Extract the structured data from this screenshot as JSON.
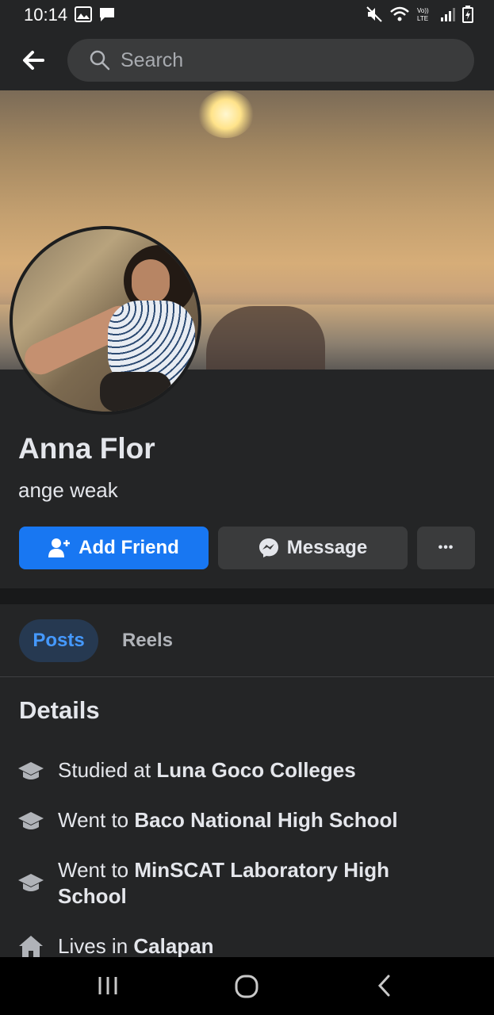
{
  "status_bar": {
    "time": "10:14",
    "left_icons": [
      "image-icon",
      "chat-icon"
    ],
    "right_icons": [
      "mute-icon",
      "wifi-icon",
      "volte-icon",
      "signal-icon",
      "battery-icon"
    ],
    "volte_label": "VoLTE"
  },
  "search": {
    "placeholder": "Search"
  },
  "profile": {
    "name": "Anna Flor",
    "bio": "ange weak"
  },
  "actions": {
    "add_friend": "Add Friend",
    "message": "Message",
    "more": "•••"
  },
  "tabs": [
    {
      "label": "Posts",
      "active": true
    },
    {
      "label": "Reels",
      "active": false
    }
  ],
  "details": {
    "title": "Details",
    "items": [
      {
        "icon": "graduation-cap-icon",
        "prefix": "Studied at ",
        "value": "Luna Goco Colleges"
      },
      {
        "icon": "graduation-cap-icon",
        "prefix": "Went to ",
        "value": "Baco National High School"
      },
      {
        "icon": "graduation-cap-icon",
        "prefix": "Went to ",
        "value": "MinSCAT Laboratory High School"
      },
      {
        "icon": "home-icon",
        "prefix": "Lives in ",
        "value": "Calapan"
      }
    ]
  },
  "colors": {
    "accent": "#1877f2",
    "background": "#242526",
    "tab_active_bg": "#263951",
    "tab_active_text": "#4599ff"
  },
  "nav_bar": {
    "buttons": [
      "recents-button",
      "home-button",
      "back-button"
    ]
  }
}
